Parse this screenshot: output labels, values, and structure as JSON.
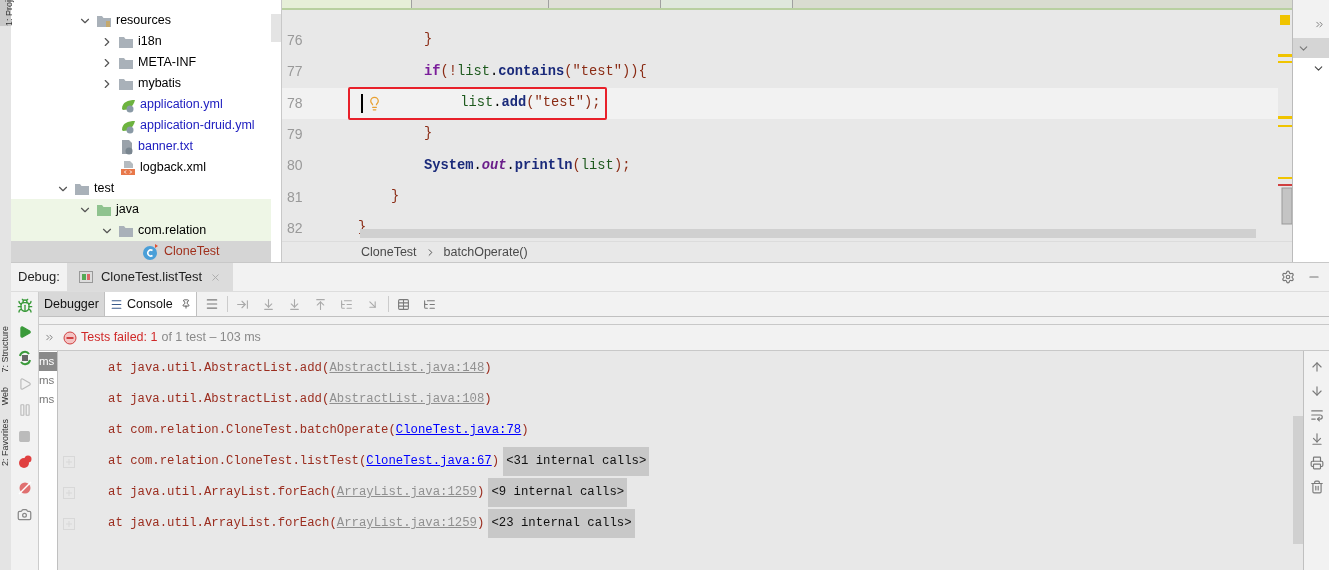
{
  "side_stripe": {
    "labels": [
      {
        "text": "1: Proj",
        "kind": "top"
      },
      {
        "text": "7: Structure",
        "kind": "bottom"
      },
      {
        "text": "Web",
        "kind": "bottom"
      },
      {
        "text": "2: Favorites",
        "kind": "bottom"
      }
    ]
  },
  "project_tree": {
    "items": [
      {
        "children": [
          {
            "label": "resources",
            "kind": "resource-folder",
            "expanded": true,
            "selected": false,
            "tinted": false,
            "children": [
              {
                "label": "i18n",
                "kind": "folder",
                "expanded": false,
                "selected": false,
                "tinted": false
              },
              {
                "label": "META-INF",
                "kind": "folder",
                "expanded": false,
                "selected": false,
                "tinted": false
              },
              {
                "label": "mybatis",
                "kind": "folder",
                "expanded": false,
                "selected": false,
                "tinted": false
              },
              {
                "label": "application.yml",
                "kind": "spring-file",
                "color": "#2020c0",
                "selected": false,
                "tinted": false
              },
              {
                "label": "application-druid.yml",
                "kind": "spring-file",
                "color": "#2020c0",
                "selected": false,
                "tinted": false
              },
              {
                "label": "banner.txt",
                "kind": "text-file",
                "color": "#2020c0",
                "selected": false,
                "tinted": false
              },
              {
                "label": "logback.xml",
                "kind": "xml-file",
                "color": "#000000",
                "selected": false,
                "tinted": false
              }
            ]
          }
        ]
      },
      {
        "label": "test",
        "kind": "folder",
        "expanded": true,
        "selected": false,
        "tinted": false,
        "children": [
          {
            "label": "java",
            "kind": "source-folder",
            "expanded": true,
            "selected": false,
            "tinted": true,
            "children": [
              {
                "label": "com.relation",
                "kind": "folder",
                "expanded": true,
                "selected": false,
                "tinted": true,
                "children": [
                  {
                    "label": "CloneTest",
                    "kind": "java-class",
                    "color": "#a0301c",
                    "selected": true,
                    "tinted": false
                  }
                ]
              }
            ]
          }
        ]
      }
    ]
  },
  "editor": {
    "lines": [
      {
        "number": "76",
        "current": false,
        "tokens": [
          {
            "kind": "punct",
            "text": "        }"
          }
        ]
      },
      {
        "number": "77",
        "current": false,
        "tokens": [
          {
            "kind": "keyword",
            "text": "        if"
          },
          {
            "kind": "punct",
            "text": "(!"
          },
          {
            "kind": "var",
            "text": "list"
          },
          {
            "kind": "plain",
            "text": "."
          },
          {
            "kind": "method",
            "text": "contains"
          },
          {
            "kind": "punct",
            "text": "("
          },
          {
            "kind": "string",
            "text": "\"test\""
          },
          {
            "kind": "punct",
            "text": ")){"
          }
        ]
      },
      {
        "number": "78",
        "current": true,
        "tokens": [
          {
            "kind": "var",
            "text": "            list"
          },
          {
            "kind": "plain",
            "text": "."
          },
          {
            "kind": "method",
            "text": "add"
          },
          {
            "kind": "punct",
            "text": "("
          },
          {
            "kind": "string",
            "text": "\"test\""
          },
          {
            "kind": "punct",
            "text": ");"
          }
        ]
      },
      {
        "number": "79",
        "current": false,
        "tokens": [
          {
            "kind": "punct",
            "text": "        }"
          }
        ]
      },
      {
        "number": "80",
        "current": false,
        "tokens": [
          {
            "kind": "method",
            "text": "        System"
          },
          {
            "kind": "plain",
            "text": "."
          },
          {
            "kind": "field",
            "text": "out"
          },
          {
            "kind": "plain",
            "text": "."
          },
          {
            "kind": "method",
            "text": "println"
          },
          {
            "kind": "punct",
            "text": "("
          },
          {
            "kind": "var",
            "text": "list"
          },
          {
            "kind": "punct",
            "text": ");"
          }
        ]
      },
      {
        "number": "81",
        "current": false,
        "tokens": [
          {
            "kind": "punct",
            "text": "    }"
          }
        ]
      },
      {
        "number": "82",
        "current": false,
        "tokens": [
          {
            "kind": "punct",
            "text": "}"
          }
        ]
      }
    ],
    "breadcrumb": [
      "CloneTest",
      "batchOperate()"
    ]
  },
  "debug": {
    "label": "Debug:",
    "session_tab": "CloneTest.listTest",
    "tabs": [
      {
        "label": "Debugger",
        "selected": false
      },
      {
        "label": "Console",
        "selected": true
      }
    ],
    "status": {
      "failed": "Tests failed: 1",
      "rest": "of 1 test – 103 ms"
    },
    "durations": [
      {
        "text": "ms",
        "selected": true
      },
      {
        "text": "ms",
        "selected": false
      },
      {
        "text": "ms",
        "selected": false
      }
    ],
    "console": [
      {
        "expandable": false,
        "parts": [
          {
            "kind": "text",
            "text": "at java.util.AbstractList.add("
          },
          {
            "kind": "link-muted",
            "text": "AbstractList.java:148"
          },
          {
            "kind": "text",
            "text": ")"
          }
        ]
      },
      {
        "expandable": false,
        "parts": [
          {
            "kind": "text",
            "text": "at java.util.AbstractList.add("
          },
          {
            "kind": "link-muted",
            "text": "AbstractList.java:108"
          },
          {
            "kind": "text",
            "text": ")"
          }
        ]
      },
      {
        "expandable": false,
        "parts": [
          {
            "kind": "text",
            "text": "at com.relation.CloneTest.batchOperate("
          },
          {
            "kind": "link",
            "text": "CloneTest.java:78"
          },
          {
            "kind": "text",
            "text": ")"
          }
        ]
      },
      {
        "expandable": true,
        "parts": [
          {
            "kind": "text",
            "text": "at com.relation.CloneTest.listTest("
          },
          {
            "kind": "link",
            "text": "CloneTest.java:67"
          },
          {
            "kind": "text",
            "text": ")"
          },
          {
            "kind": "folded",
            "text": "<31 internal calls>"
          }
        ]
      },
      {
        "expandable": true,
        "parts": [
          {
            "kind": "text",
            "text": "at java.util.ArrayList.forEach("
          },
          {
            "kind": "link-muted",
            "text": "ArrayList.java:1259"
          },
          {
            "kind": "text",
            "text": ")"
          },
          {
            "kind": "folded",
            "text": "<9 internal calls>"
          }
        ]
      },
      {
        "expandable": true,
        "parts": [
          {
            "kind": "text",
            "text": "at java.util.ArrayList.forEach("
          },
          {
            "kind": "link-muted",
            "text": "ArrayList.java:1259"
          },
          {
            "kind": "text",
            "text": ")"
          },
          {
            "kind": "folded",
            "text": "<23 internal calls>"
          }
        ]
      }
    ]
  }
}
